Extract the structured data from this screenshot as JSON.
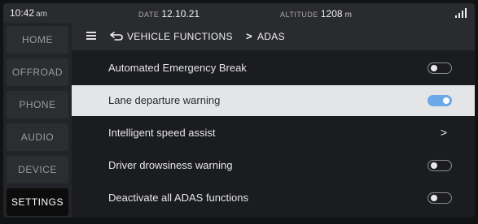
{
  "status": {
    "time": "10:42",
    "ampm": "am",
    "date_label": "DATE",
    "date": "12.10.21",
    "altitude_label": "ALTITUDE",
    "altitude": "1208",
    "altitude_unit": "m"
  },
  "sidebar": {
    "items": [
      {
        "label": "HOME"
      },
      {
        "label": "OFFROAD"
      },
      {
        "label": "PHONE"
      },
      {
        "label": "AUDIO"
      },
      {
        "label": "DEVICE"
      },
      {
        "label": "SETTINGS"
      }
    ],
    "active": "SETTINGS"
  },
  "breadcrumb": {
    "parent": "VEHICLE FUNCTIONS",
    "separator": ">",
    "current": "ADAS"
  },
  "settings": {
    "rows": [
      {
        "label": "Automated Emergency Break",
        "control": "toggle",
        "state": "off"
      },
      {
        "label": "Lane departure warning",
        "control": "toggle",
        "state": "on"
      },
      {
        "label": "Intelligent speed assist",
        "control": "chevron",
        "chevron": ">"
      },
      {
        "label": "Driver drowsiness warning",
        "control": "toggle",
        "state": "off"
      },
      {
        "label": "Deactivate all ADAS functions",
        "control": "toggle",
        "state": "off"
      }
    ],
    "selected_row": "Lane departure warning"
  },
  "colors": {
    "accent_toggle": "#6aa8e6",
    "selected_row_bg": "#e4e5e7",
    "active_sidebar_bg": "#0c0c0d"
  }
}
